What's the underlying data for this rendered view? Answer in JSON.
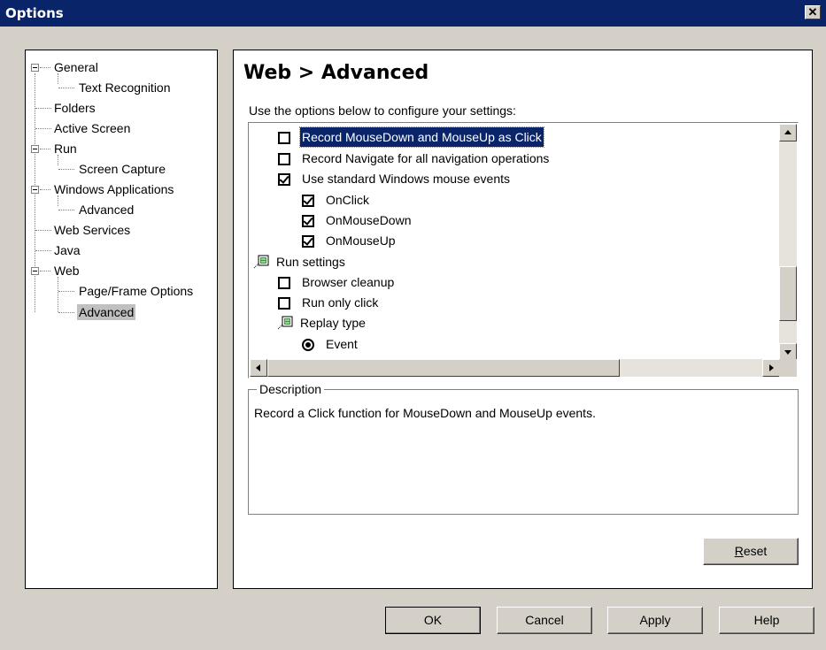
{
  "window": {
    "title": "Options",
    "close_symbol": "✕"
  },
  "tree": {
    "items": [
      {
        "label": "General",
        "expanded": true
      },
      {
        "label": "Text Recognition"
      },
      {
        "label": "Folders"
      },
      {
        "label": "Active Screen"
      },
      {
        "label": "Run",
        "expanded": true
      },
      {
        "label": "Screen Capture"
      },
      {
        "label": "Windows Applications",
        "expanded": true
      },
      {
        "label": "Advanced"
      },
      {
        "label": "Web Services"
      },
      {
        "label": "Java"
      },
      {
        "label": "Web",
        "expanded": true
      },
      {
        "label": "Page/Frame Options"
      },
      {
        "label": "Advanced",
        "selected": true
      }
    ]
  },
  "main": {
    "title": "Web > Advanced",
    "intro": "Use the options below to configure your settings:",
    "options": [
      {
        "label": "Record MouseDown and MouseUp as Click",
        "type": "checkbox",
        "checked": false,
        "highlighted": true
      },
      {
        "label": "Record Navigate for all navigation operations",
        "type": "checkbox",
        "checked": false
      },
      {
        "label": "Use standard Windows mouse events",
        "type": "checkbox",
        "checked": true
      },
      {
        "label": "OnClick",
        "type": "checkbox",
        "checked": true
      },
      {
        "label": "OnMouseDown",
        "type": "checkbox",
        "checked": true
      },
      {
        "label": "OnMouseUp",
        "type": "checkbox",
        "checked": true
      },
      {
        "label": "Run settings",
        "type": "group"
      },
      {
        "label": "Browser cleanup",
        "type": "checkbox",
        "checked": false
      },
      {
        "label": "Run only click",
        "type": "checkbox",
        "checked": false
      },
      {
        "label": "Replay type",
        "type": "group"
      },
      {
        "label": "Event",
        "type": "radio",
        "checked": true
      }
    ],
    "description": {
      "label": "Description",
      "text": "Record a Click function for MouseDown and MouseUp events."
    },
    "reset_label": "Reset"
  },
  "buttons": {
    "ok": "OK",
    "cancel": "Cancel",
    "apply": "Apply",
    "help": "Help"
  },
  "colors": {
    "titlebar": "#0a246a",
    "dialog": "#d4d0c8",
    "selection": "#0a246a"
  }
}
